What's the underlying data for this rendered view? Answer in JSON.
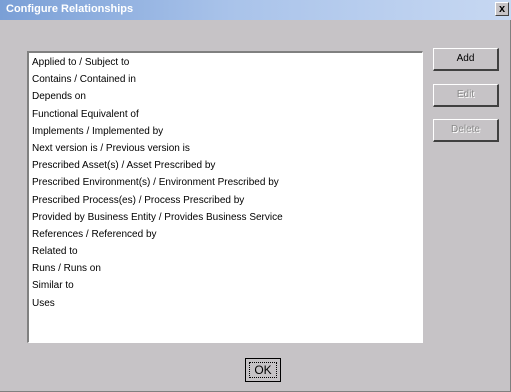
{
  "window": {
    "title": "Configure Relationships",
    "close_label": "x"
  },
  "relationships": {
    "items": [
      "Applied to / Subject to",
      "Contains / Contained in",
      "Depends on",
      "Functional Equivalent of",
      "Implements / Implemented by",
      "Next version is / Previous version is",
      "Prescribed Asset(s) / Asset Prescribed by",
      "Prescribed Environment(s) / Environment Prescribed by",
      "Prescribed Process(es) / Process Prescribed by",
      "Provided by Business Entity / Provides Business Service",
      "References / Referenced by",
      "Related to",
      "Runs / Runs on",
      "Similar to",
      "Uses"
    ]
  },
  "buttons": {
    "add": "Add",
    "edit": "Edit",
    "delete": "Delete",
    "ok": "OK"
  },
  "colors": {
    "dialog_bg": "#c6c3c6",
    "titlebar_start": "#7a9fd6",
    "titlebar_end": "#c7d8f2",
    "title_text": "#ffffff",
    "disabled_text": "#8a8a8a"
  }
}
